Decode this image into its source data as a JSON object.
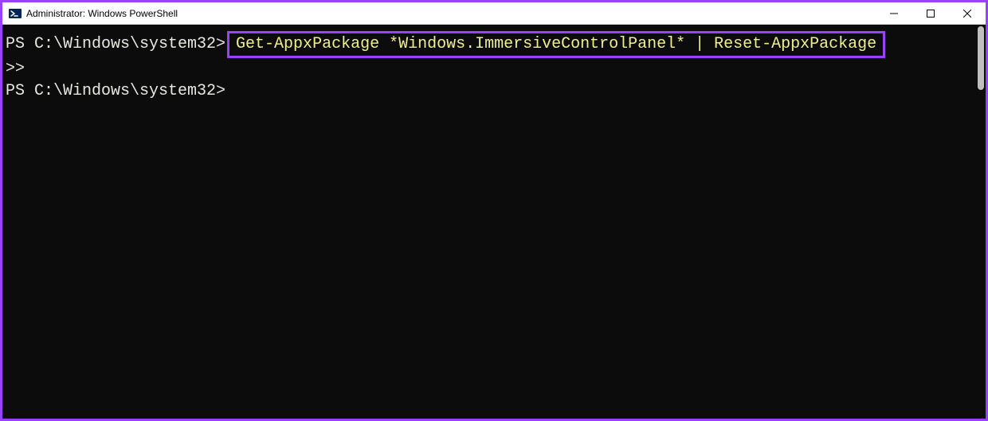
{
  "window": {
    "title": "Administrator: Windows PowerShell",
    "controls": {
      "min": "minimize",
      "max": "maximize",
      "close": "close"
    }
  },
  "console": {
    "prompt1": "PS C:\\Windows\\system32>",
    "command_highlighted": "Get-AppxPackage *Windows.ImmersiveControlPanel* | Reset-AppxPackage",
    "continuation": ">>",
    "prompt2": "PS C:\\Windows\\system32>"
  },
  "colors": {
    "accent_highlight": "#9A40FF",
    "cmd_text": "#f0f08a"
  }
}
